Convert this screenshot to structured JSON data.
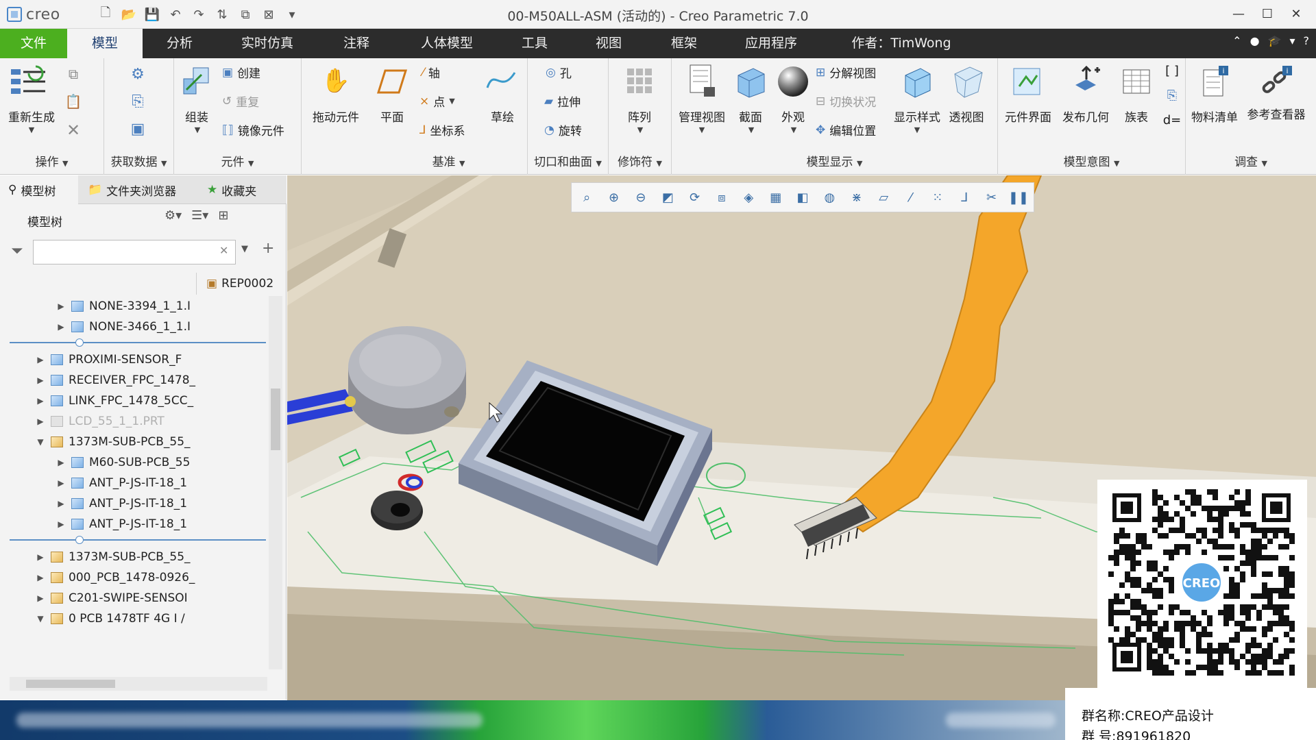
{
  "app": {
    "logo_text": "creo",
    "window_title": "00-M50ALL-ASM (活动的) - Creo Parametric 7.0",
    "window_controls": [
      "minimize-icon",
      "maximize-icon",
      "close-icon"
    ]
  },
  "quick_access": [
    "new-icon",
    "open-icon",
    "save-icon",
    "undo-icon",
    "redo-icon",
    "regenerate-icon",
    "windows-icon",
    "close-window-icon",
    "customize-icon"
  ],
  "tabs": [
    {
      "label": "文件"
    },
    {
      "label": "模型"
    },
    {
      "label": "分析"
    },
    {
      "label": "实时仿真"
    },
    {
      "label": "注释"
    },
    {
      "label": "人体模型"
    },
    {
      "label": "工具"
    },
    {
      "label": "视图"
    },
    {
      "label": "框架"
    },
    {
      "label": "应用程序"
    },
    {
      "label": "作者：TimWong"
    }
  ],
  "active_tab": "模型",
  "ribbon": {
    "groups": [
      {
        "label": "操作",
        "items": [
          "重新生成"
        ]
      },
      {
        "label": "获取数据",
        "items": []
      },
      {
        "label": "元件",
        "items": [
          "组装",
          "创建",
          "重复",
          "镜像元件",
          "拖动元件"
        ]
      },
      {
        "label": "基准",
        "items": [
          "平面",
          "轴",
          "点",
          "坐标系",
          "草绘"
        ]
      },
      {
        "label": "切口和曲面",
        "items": [
          "孔",
          "拉伸",
          "旋转"
        ]
      },
      {
        "label": "修饰符",
        "items": [
          "阵列"
        ]
      },
      {
        "label": "模型显示",
        "items": [
          "管理视图",
          "截面",
          "外观",
          "分解视图",
          "切换状况",
          "编辑位置",
          "显示样式",
          "透视图"
        ]
      },
      {
        "label": "模型意图",
        "items": [
          "元件界面",
          "发布几何",
          "族表"
        ]
      },
      {
        "label": "调查",
        "items": [
          "物料清单",
          "参考查看器"
        ]
      }
    ],
    "side_symbol": "d="
  },
  "left_panel": {
    "tabs": [
      {
        "label": "模型树"
      },
      {
        "label": "文件夹浏览器"
      },
      {
        "label": "收藏夹"
      }
    ],
    "tree_title": "模型树",
    "search_value": "",
    "column_header": "REP0002",
    "rows_group1": [
      {
        "label": "NONE-3394_1_1.I"
      },
      {
        "label": "NONE-3466_1_1.I"
      }
    ],
    "rows_group2": [
      {
        "label": "PROXIMI-SENSOR_F"
      },
      {
        "label": "RECEIVER_FPC_1478_"
      },
      {
        "label": "LINK_FPC_1478_5CC_"
      },
      {
        "label": "LCD_55_1_1.PRT",
        "dimmed": true
      },
      {
        "label": "1373M-SUB-PCB_55_"
      },
      {
        "label": "M60-SUB-PCB_55"
      },
      {
        "label": "ANT_P-JS-IT-18_1"
      },
      {
        "label": "ANT_P-JS-IT-18_1"
      },
      {
        "label": "ANT_P-JS-IT-18_1"
      }
    ],
    "rows_group3": [
      {
        "label": "1373M-SUB-PCB_55_"
      },
      {
        "label": "000_PCB_1478-0926_"
      },
      {
        "label": "C201-SWIPE-SENSOI"
      },
      {
        "label": "0 PCB 1478TF 4G I /"
      }
    ]
  },
  "view_toolbar": [
    "refit-icon",
    "zoom-in-icon",
    "zoom-out-icon",
    "repaint-icon",
    "spin-center-icon",
    "saved-orientations-icon",
    "display-style-icon",
    "saved-views-icon",
    "perspective-icon",
    "appearance-icon",
    "datum-display-icon",
    "annotation-display-icon",
    "axis-display-icon",
    "point-display-icon",
    "csys-display-icon",
    "spin-icon",
    "pause-icon"
  ],
  "qr_info": {
    "group_name": "群名称:CREO产品设计",
    "group_number": "群    号:891961820"
  },
  "colors": {
    "file_tab": "#4caf1f",
    "tab_bar": "#2c2c2c",
    "flex_cable": "#f4a62a",
    "model_base": "#d6ccb8"
  }
}
